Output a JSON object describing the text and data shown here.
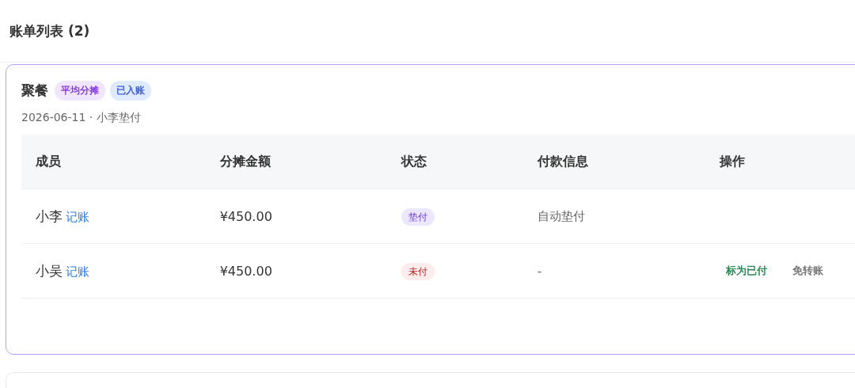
{
  "header": {
    "title": "账单列表 (2)"
  },
  "bills": [
    {
      "title": "聚餐",
      "tags": [
        {
          "label": "平均分摊",
          "kind": "split"
        },
        {
          "label": "已入账",
          "kind": "posted"
        }
      ],
      "meta": "2026-06-11 · 小李垫付",
      "selected": true,
      "table": {
        "columns": [
          "成员",
          "分摊金额",
          "状态",
          "付款信息",
          "操作"
        ],
        "rows": [
          {
            "member": "小李",
            "link": "记账",
            "amount": "¥450.00",
            "status": {
              "label": "垫付",
              "kind": "advanced"
            },
            "payment": "自动垫付",
            "actions": []
          },
          {
            "member": "小吴",
            "link": "记账",
            "amount": "¥450.00",
            "status": {
              "label": "未付",
              "kind": "unpaid"
            },
            "payment": "-",
            "actions": [
              {
                "label": "标为已付",
                "kind": "confirm"
              },
              {
                "label": "免转账",
                "kind": "waive"
              }
            ]
          }
        ]
      }
    },
    {
      "selected": false
    }
  ]
}
